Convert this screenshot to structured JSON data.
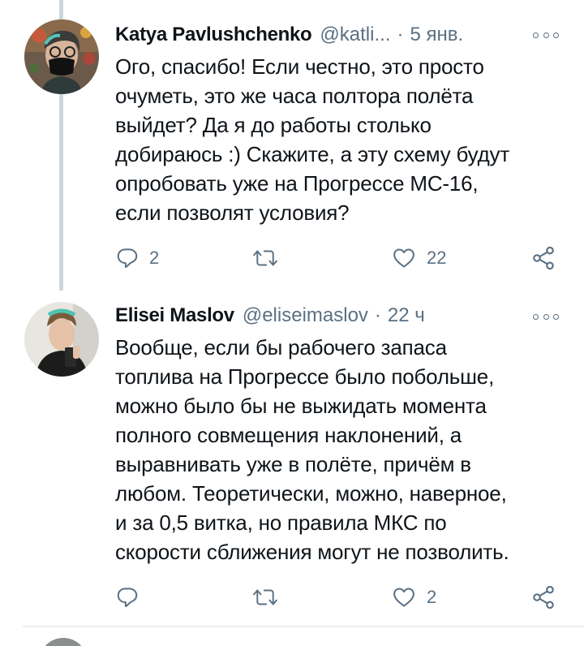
{
  "tweets": [
    {
      "name": "Katya Pavlushchenko",
      "handle": "@katli...",
      "separator": "·",
      "time": "5 янв.",
      "text": "Ого, спасибо! Если честно, это просто очуметь, это же часа полтора полёта выйдет? Да я до работы столько добираюсь :) Скажите, а эту схему будут опробовать уже на Прогрессе МС-16, если позволят условия?",
      "lines": [
        "Ого, спасибо! Если честно, это просто",
        "очуметь, это же часа полтора полёта",
        "выйдет? Да я до работы столько",
        "добираюсь :) Скажите, а эту схему будут",
        "опробовать уже на Прогрессе МС-16,",
        "если позволят условия?"
      ],
      "reply_count": "2",
      "retweet_count": "",
      "like_count": "22",
      "icons": {
        "reply": "reply-icon",
        "retweet": "retweet-icon",
        "like": "like-icon",
        "share": "share-icon",
        "more": "more-icon"
      }
    },
    {
      "name": "Elisei Maslov",
      "handle": "@eliseimaslov",
      "separator": "·",
      "time": "22 ч",
      "lines": [
        "Вообще, если бы рабочего запаса",
        "топлива на Прогрессе было побольше,",
        "можно было бы не выжидать момента",
        "полного совмещения наклонений, а",
        "выравнивать уже в полёте, причём в",
        "любом. Теоретически, можно, наверное,",
        "и за 0,5 витка, но правила МКС по",
        "скорости сближения могут не позволить."
      ],
      "reply_count": "",
      "retweet_count": "",
      "like_count": "2",
      "icons": {
        "reply": "reply-icon",
        "retweet": "retweet-icon",
        "like": "like-icon",
        "share": "share-icon",
        "more": "more-icon"
      }
    }
  ],
  "colors": {
    "text": "#0f1419",
    "secondary": "#5b7083",
    "thread_line": "#ccd6dd",
    "divider": "#ebeef0"
  }
}
